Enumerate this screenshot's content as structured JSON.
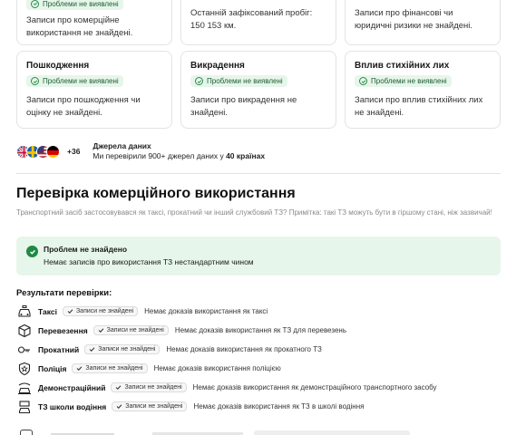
{
  "top_cards": [
    {
      "badge": "Проблеми не виявлені",
      "desc": "Записи про комерційне використання не знайдені."
    },
    {
      "badge": "",
      "desc": "Останній зафіксований пробіг: 150 153 км."
    },
    {
      "badge": "",
      "desc": "Записи про фінансові чи юридичні ризики не знайдені."
    }
  ],
  "cards": [
    {
      "title": "Пошкодження",
      "badge": "Проблеми не виявлені",
      "desc": "Записи про пошкодження чи оцінку не знайдені."
    },
    {
      "title": "Викрадення",
      "badge": "Проблеми не виявлені",
      "desc": "Записи про викрадення не знайдені."
    },
    {
      "title": "Вплив стихійних лих",
      "badge": "Проблеми не виявлені",
      "desc": "Записи про вплив стихійних лих не знайдені."
    }
  ],
  "sources": {
    "more": "+36",
    "title": "Джерела даних",
    "text_prefix": "Ми перевірили 900+ джерел даних у ",
    "text_bold": "40 країнах"
  },
  "commercial": {
    "title": "Перевірка комерційного використання",
    "desc": "Транспортний засіб застосовувався як таксі, прокатний чи інший службовий ТЗ? Примітка: такі ТЗ можуть бути в гіршому стані, ніж зазвичай!",
    "ok_title": "Проблем не знайдено",
    "ok_desc": "Немає записів про використання ТЗ нестандартним чином",
    "results_title": "Результати перевірки:",
    "results": [
      {
        "name": "Таксі",
        "badge": "Записи не знайдені",
        "text": "Немає доказів використання як таксі",
        "icon": "taxi-icon"
      },
      {
        "name": "Перевезення",
        "badge": "Записи не знайдені",
        "text": "Немає доказів використання як ТЗ для перевезень",
        "icon": "box-icon"
      },
      {
        "name": "Прокатний",
        "badge": "Записи не знайдені",
        "text": "Немає доказів використання як прокатного ТЗ",
        "icon": "car-key-icon"
      },
      {
        "name": "Поліція",
        "badge": "Записи не знайдені",
        "text": "Немає доказів використання поліцією",
        "icon": "police-badge-icon"
      },
      {
        "name": "Демонстраційний",
        "badge": "Записи не знайдені",
        "text": "Немає доказів використання як демонстраційного транспортного засобу",
        "icon": "showroom-car-icon"
      },
      {
        "name": "ТЗ школи водіння",
        "badge": "Записи не знайдені",
        "text": "Немає доказів використання як ТЗ в школі водіння",
        "icon": "driving-school-icon"
      }
    ]
  },
  "colors": {
    "success_bg": "#e7f6ea",
    "success_icon": "#1f8a43",
    "badge_bg": "#e6f6ea"
  }
}
